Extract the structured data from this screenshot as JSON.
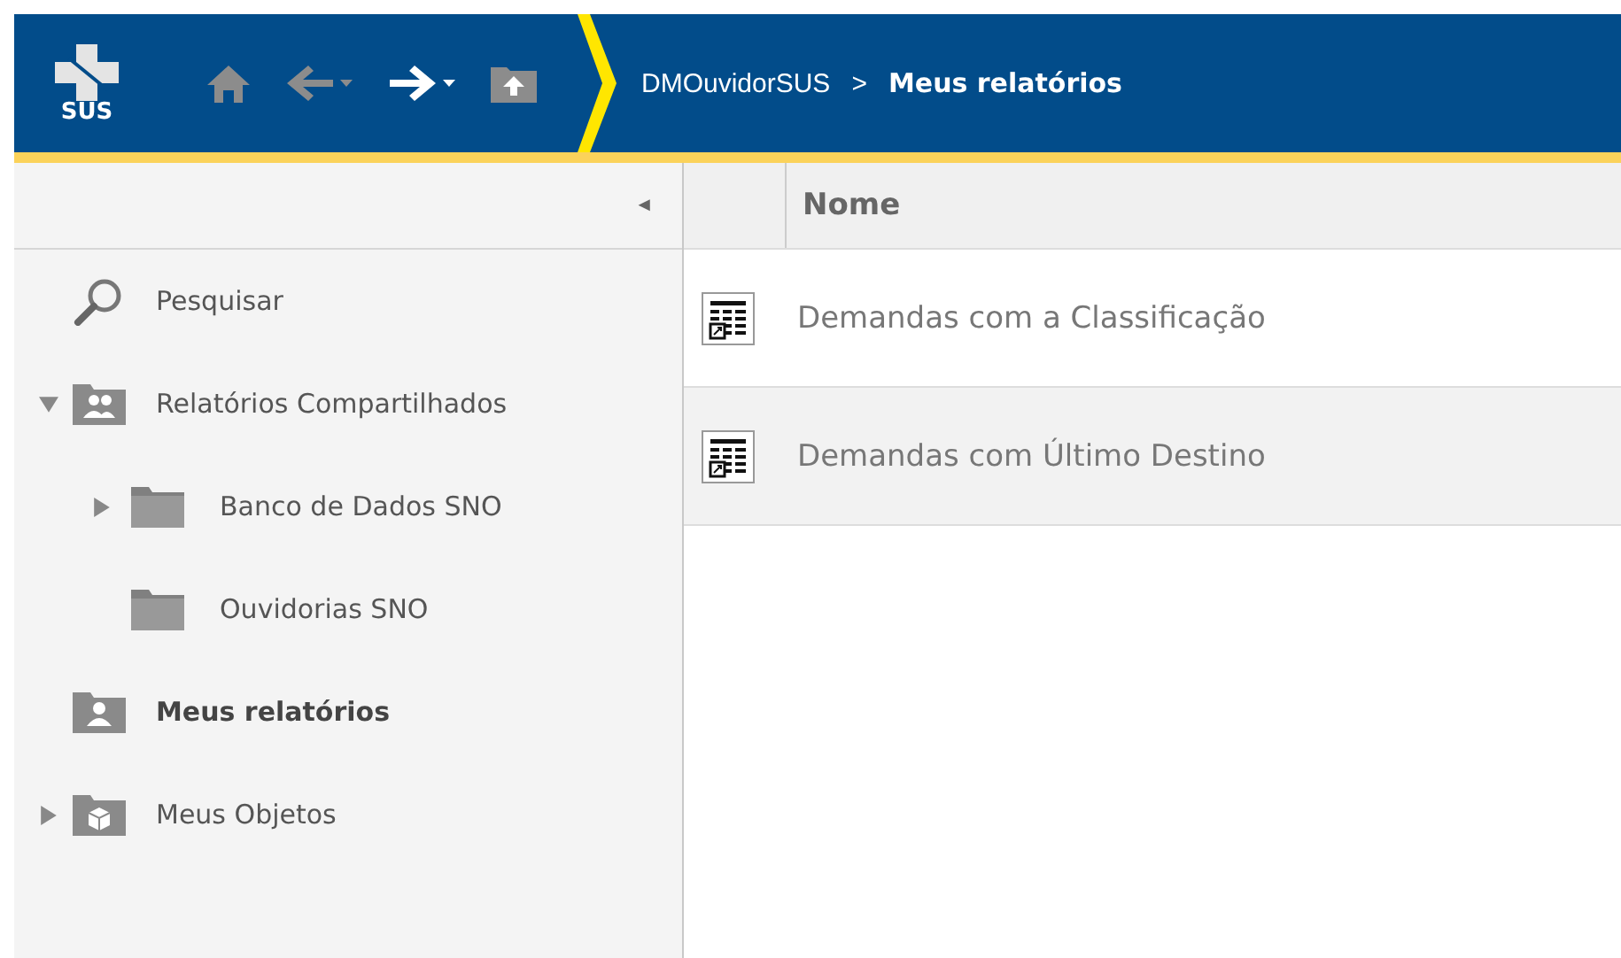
{
  "header": {
    "logo_text": "SUS",
    "nav": [
      {
        "kind": "home",
        "disabled": true
      },
      {
        "kind": "back",
        "disabled": true
      },
      {
        "kind": "forward",
        "disabled": false
      },
      {
        "kind": "up",
        "disabled": true
      }
    ],
    "breadcrumb": [
      {
        "label": "DMOuvidorSUS",
        "current": false
      },
      {
        "label": ">",
        "current": false
      },
      {
        "label": "Meus relatórios",
        "current": true
      }
    ]
  },
  "sidebar": {
    "collapse_glyph": "◄",
    "items": [
      {
        "kind": "search",
        "label": "Pesquisar",
        "selected": false
      },
      {
        "kind": "shared",
        "label": "Relatórios Compartilhados",
        "selected": false,
        "expanded": true,
        "children": [
          {
            "kind": "folder",
            "label": "Banco de Dados SNO",
            "selected": false,
            "expanded": false,
            "has_children": true
          },
          {
            "kind": "folder",
            "label": "Ouvidorias SNO",
            "selected": false
          }
        ]
      },
      {
        "kind": "user",
        "label": "Meus relatórios",
        "selected": true
      },
      {
        "kind": "objects",
        "label": "Meus Objetos",
        "selected": false,
        "expanded": false,
        "has_children": true
      }
    ]
  },
  "table": {
    "columns": [
      "Nome"
    ],
    "rows": [
      {
        "name": "Demandas com a Classificação",
        "selected": false
      },
      {
        "name": "Demandas com Último Destino",
        "selected": true
      }
    ]
  }
}
